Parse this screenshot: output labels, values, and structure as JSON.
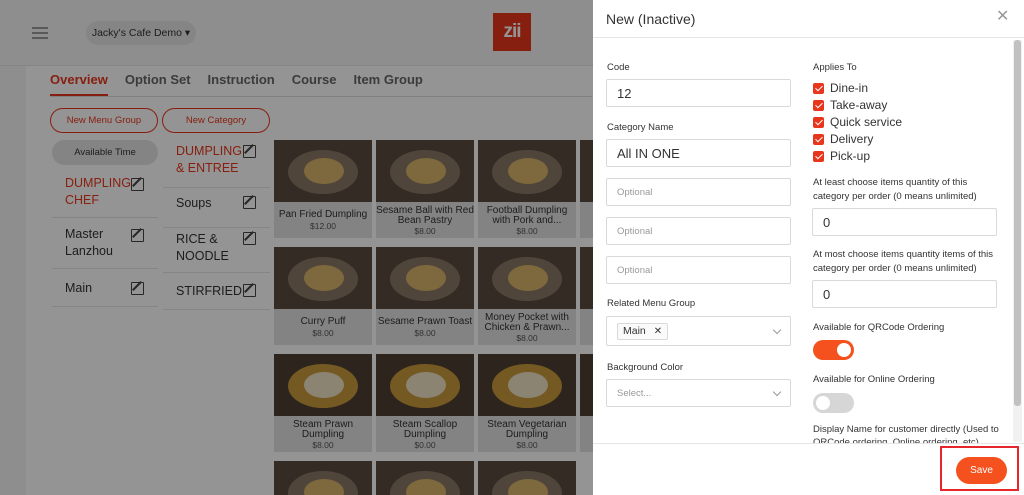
{
  "header": {
    "cafe_name": "Jacky's Cafe Demo ▾",
    "logo_text": "zii"
  },
  "tabs": [
    {
      "label": "Overview",
      "active": true
    },
    {
      "label": "Option Set",
      "active": false
    },
    {
      "label": "Instruction",
      "active": false
    },
    {
      "label": "Course",
      "active": false
    },
    {
      "label": "Item Group",
      "active": false
    }
  ],
  "buttons": {
    "new_menu_group": "New Menu Group",
    "new_category": "New Category",
    "available_time": "Available Time"
  },
  "menu_groups": [
    {
      "label": "DUMPLING CHEF",
      "active": true
    },
    {
      "label": "Master Lanzhou",
      "active": false
    },
    {
      "label": "Main",
      "active": false
    }
  ],
  "categories": [
    {
      "label": "DUMPLING & ENTREE",
      "active": true
    },
    {
      "label": "Soups",
      "active": false
    },
    {
      "label": "RICE & NOODLE",
      "active": false
    },
    {
      "label": "STIRFRIED",
      "active": false
    }
  ],
  "items": [
    {
      "name": "Pan Fried Dumpling",
      "price": "$12.00"
    },
    {
      "name": "Sesame Ball with Red Bean Pastry",
      "price": "$8.00"
    },
    {
      "name": "Football Dumpling with Pork and...",
      "price": "$8.00"
    },
    {
      "name": "Curry Puff",
      "price": "$8.00"
    },
    {
      "name": "Sesame Prawn Toast",
      "price": "$8.00"
    },
    {
      "name": "Money Pocket with Chicken & Prawn...",
      "price": "$8.00"
    },
    {
      "name": "Steam Prawn Dumpling",
      "price": "$8.00"
    },
    {
      "name": "Steam Scallop Dumpling",
      "price": "$0.00"
    },
    {
      "name": "Steam Vegetarian Dumpling",
      "price": "$8.00"
    }
  ],
  "drawer": {
    "title": "New (Inactive)",
    "code_label": "Code",
    "code_value": "12",
    "category_name_label": "Category Name",
    "category_name_value": "All IN ONE",
    "optional_placeholder": "Optional",
    "related_menu_group_label": "Related Menu Group",
    "related_menu_group_tag": "Main",
    "background_color_label": "Background Color",
    "background_color_placeholder": "Select...",
    "applies_to_label": "Applies To",
    "applies_to": [
      {
        "label": "Dine-in",
        "checked": true
      },
      {
        "label": "Take-away",
        "checked": true
      },
      {
        "label": "Quick service",
        "checked": true
      },
      {
        "label": "Delivery",
        "checked": true
      },
      {
        "label": "Pick-up",
        "checked": true
      }
    ],
    "min_qty_label_1": "At least choose items quantity of this",
    "min_qty_label_2": "category per order (0 means unlimited)",
    "min_qty_value": "0",
    "max_qty_label_1": "At most choose items quantity items of this",
    "max_qty_label_2": "category per order (0 means unlimited)",
    "max_qty_value": "0",
    "qrcode_label": "Available for QRCode Ordering",
    "qrcode_on": true,
    "online_label": "Available for Online Ordering",
    "online_on": false,
    "display_name_label_1": "Display Name for customer directly (Used to",
    "display_name_label_2": "QRCode ordering, Online ordering, etc)",
    "save_label": "Save"
  },
  "colors": {
    "accent": "#e8361c",
    "toggle_on": "#f4511e",
    "highlight": "#e5262d"
  }
}
